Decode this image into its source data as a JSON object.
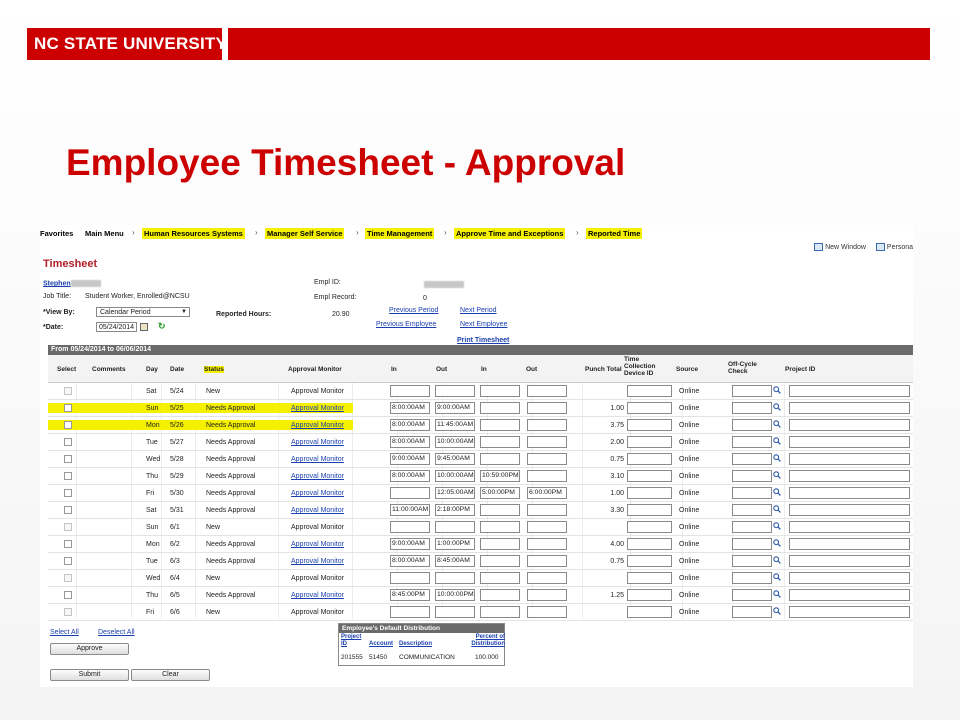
{
  "slide": {
    "logo_text": "NC STATE UNIVERSITY",
    "title": "Employee Timesheet - Approval",
    "brand_color": "#cc0000"
  },
  "app": {
    "menu": [
      "Favorites",
      "Main Menu",
      "Human Resources Systems",
      "Manager Self Service",
      "Time Management",
      "Approve Time and Exceptions",
      "Reported Time"
    ],
    "toplinks": [
      "New Window",
      "Persona"
    ],
    "page_title": "Timesheet",
    "employee": {
      "name": "Stephen",
      "job_title_label": "Job Title:",
      "job_title": "Student Worker, Enrolled@NCSU",
      "view_by_label": "*View By:",
      "view_by": "Calendar Period",
      "date_label": "*Date:",
      "date": "05/24/2014",
      "empl_id_label": "Empl ID:",
      "empl_record_label": "Empl Record:",
      "empl_record": "0",
      "reported_hours_label": "Reported Hours:",
      "reported_hours": "20.90"
    },
    "nav_links": {
      "previous_period": "Previous Period",
      "next_period": "Next Period",
      "previous_employee": "Previous Employee",
      "next_employee": "Next Employee",
      "print_timesheet": "Print Timesheet"
    },
    "grid": {
      "period": "From 05/24/2014 to 06/06/2014",
      "columns": {
        "select": "Select",
        "comments": "Comments",
        "day": "Day",
        "date": "Date",
        "status": "Status",
        "approval_monitor": "Approval Monitor",
        "in1": "In",
        "out1": "Out",
        "in2": "In",
        "out2": "Out",
        "punch_total": "Punch Total",
        "tcd_id": "Time Collection Device ID",
        "source": "Source",
        "off_cycle": "Off-Cycle Check",
        "project_id": "Project ID"
      },
      "rows": [
        {
          "day": "Sat",
          "date": "5/24",
          "status": "New",
          "monitor": "Approval Monitor",
          "in1": "",
          "out1": "",
          "in2": "",
          "out2": "",
          "total": "",
          "source": "Online"
        },
        {
          "day": "Sun",
          "date": "5/25",
          "status": "Needs Approval",
          "monitor": "Approval Monitor",
          "in1": "8:00:00AM",
          "out1": "9:00:00AM",
          "in2": "",
          "out2": "",
          "total": "1.00",
          "source": "Online"
        },
        {
          "day": "Mon",
          "date": "5/26",
          "status": "Needs Approval",
          "monitor": "Approval Monitor",
          "in1": "8:00:00AM",
          "out1": "11:45:00AM",
          "in2": "",
          "out2": "",
          "total": "3.75",
          "source": "Online"
        },
        {
          "day": "Tue",
          "date": "5/27",
          "status": "Needs Approval",
          "monitor": "Approval Monitor",
          "in1": "8:00:00AM",
          "out1": "10:00:00AM",
          "in2": "",
          "out2": "",
          "total": "2.00",
          "source": "Online"
        },
        {
          "day": "Wed",
          "date": "5/28",
          "status": "Needs Approval",
          "monitor": "Approval Monitor",
          "in1": "9:00:00AM",
          "out1": "9:45:00AM",
          "in2": "",
          "out2": "",
          "total": "0.75",
          "source": "Online"
        },
        {
          "day": "Thu",
          "date": "5/29",
          "status": "Needs Approval",
          "monitor": "Approval Monitor",
          "in1": "8:00:00AM",
          "out1": "10:00:00AM",
          "in2": "10:59:00PM",
          "out2": "",
          "total": "3.10",
          "source": "Online"
        },
        {
          "day": "Fri",
          "date": "5/30",
          "status": "Needs Approval",
          "monitor": "Approval Monitor",
          "in1": "",
          "out1": "12:05:00AM",
          "in2": "5:00:00PM",
          "out2": "6:00:00PM",
          "total": "1.00",
          "source": "Online"
        },
        {
          "day": "Sat",
          "date": "5/31",
          "status": "Needs Approval",
          "monitor": "Approval Monitor",
          "in1": "11:00:00AM",
          "out1": "2:18:00PM",
          "in2": "",
          "out2": "",
          "total": "3.30",
          "source": "Online"
        },
        {
          "day": "Sun",
          "date": "6/1",
          "status": "New",
          "monitor": "Approval Monitor",
          "in1": "",
          "out1": "",
          "in2": "",
          "out2": "",
          "total": "",
          "source": "Online"
        },
        {
          "day": "Mon",
          "date": "6/2",
          "status": "Needs Approval",
          "monitor": "Approval Monitor",
          "in1": "9:00:00AM",
          "out1": "1:00:00PM",
          "in2": "",
          "out2": "",
          "total": "4.00",
          "source": "Online"
        },
        {
          "day": "Tue",
          "date": "6/3",
          "status": "Needs Approval",
          "monitor": "Approval Monitor",
          "in1": "8:00:00AM",
          "out1": "8:45:00AM",
          "in2": "",
          "out2": "",
          "total": "0.75",
          "source": "Online"
        },
        {
          "day": "Wed",
          "date": "6/4",
          "status": "New",
          "monitor": "Approval Monitor",
          "in1": "",
          "out1": "",
          "in2": "",
          "out2": "",
          "total": "",
          "source": "Online"
        },
        {
          "day": "Thu",
          "date": "6/5",
          "status": "Needs Approval",
          "monitor": "Approval Monitor",
          "in1": "8:45:00PM",
          "out1": "10:00:00PM",
          "in2": "",
          "out2": "",
          "total": "1.25",
          "source": "Online"
        },
        {
          "day": "Fri",
          "date": "6/6",
          "status": "New",
          "monitor": "Approval Monitor",
          "in1": "",
          "out1": "",
          "in2": "",
          "out2": "",
          "total": "",
          "source": "Online"
        }
      ]
    },
    "actions": {
      "select_all": "Select All",
      "deselect_all": "Deselect All",
      "approve": "Approve",
      "submit": "Submit",
      "clear": "Clear"
    },
    "distribution": {
      "title": "Employee's Default Distribution",
      "headers": [
        "Project ID",
        "Account",
        "Description",
        "Percent of Distribution"
      ],
      "row": [
        "201555",
        "51450",
        "COMMUNICATION",
        "100.000"
      ]
    },
    "highlight_color": "#f4f000"
  }
}
